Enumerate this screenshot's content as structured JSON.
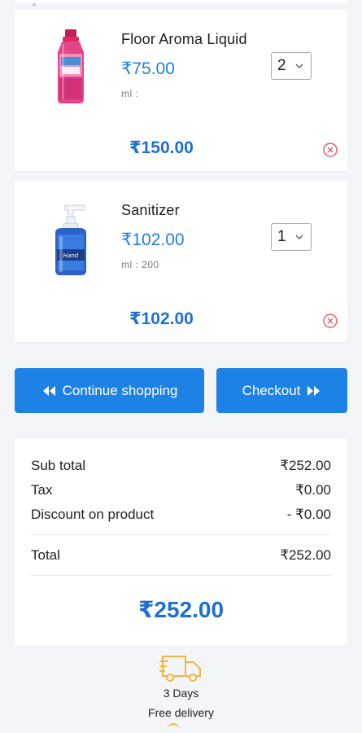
{
  "currency_symbol": "₹",
  "colors": {
    "accent": "#1d82e6",
    "price_blue": "#1e7fe0",
    "remove_red": "#e05a67",
    "delivery_orange": "#f3b340",
    "background": "#f4f5f8"
  },
  "cart": {
    "items": [
      {
        "name": "Floor Aroma Liquid",
        "price": "₹75.00",
        "meta": "ml :",
        "quantity": "2",
        "line_total": "₹150.00",
        "image_icon": "pink-bottle-icon",
        "remove_icon": "remove-circle-icon"
      },
      {
        "name": "Sanitizer",
        "price": "₹102.00",
        "meta": "ml :   200",
        "quantity": "1",
        "line_total": "₹102.00",
        "image_icon": "pump-bottle-icon",
        "remove_icon": "remove-circle-icon"
      }
    ]
  },
  "actions": {
    "continue_label": "Continue shopping",
    "continue_icon": "double-chevron-left-icon",
    "checkout_label": "Checkout",
    "checkout_icon": "double-chevron-right-icon"
  },
  "summary": {
    "subtotal_label": "Sub total",
    "subtotal_value": "₹252.00",
    "tax_label": "Tax",
    "tax_value": "₹0.00",
    "discount_label": "Discount on product",
    "discount_value": "- ₹0.00",
    "total_label": "Total",
    "total_value": "₹252.00",
    "grand_total": "₹252.00"
  },
  "delivery": {
    "icon": "delivery-truck-icon",
    "days": "3 Days",
    "label": "Free delivery"
  }
}
